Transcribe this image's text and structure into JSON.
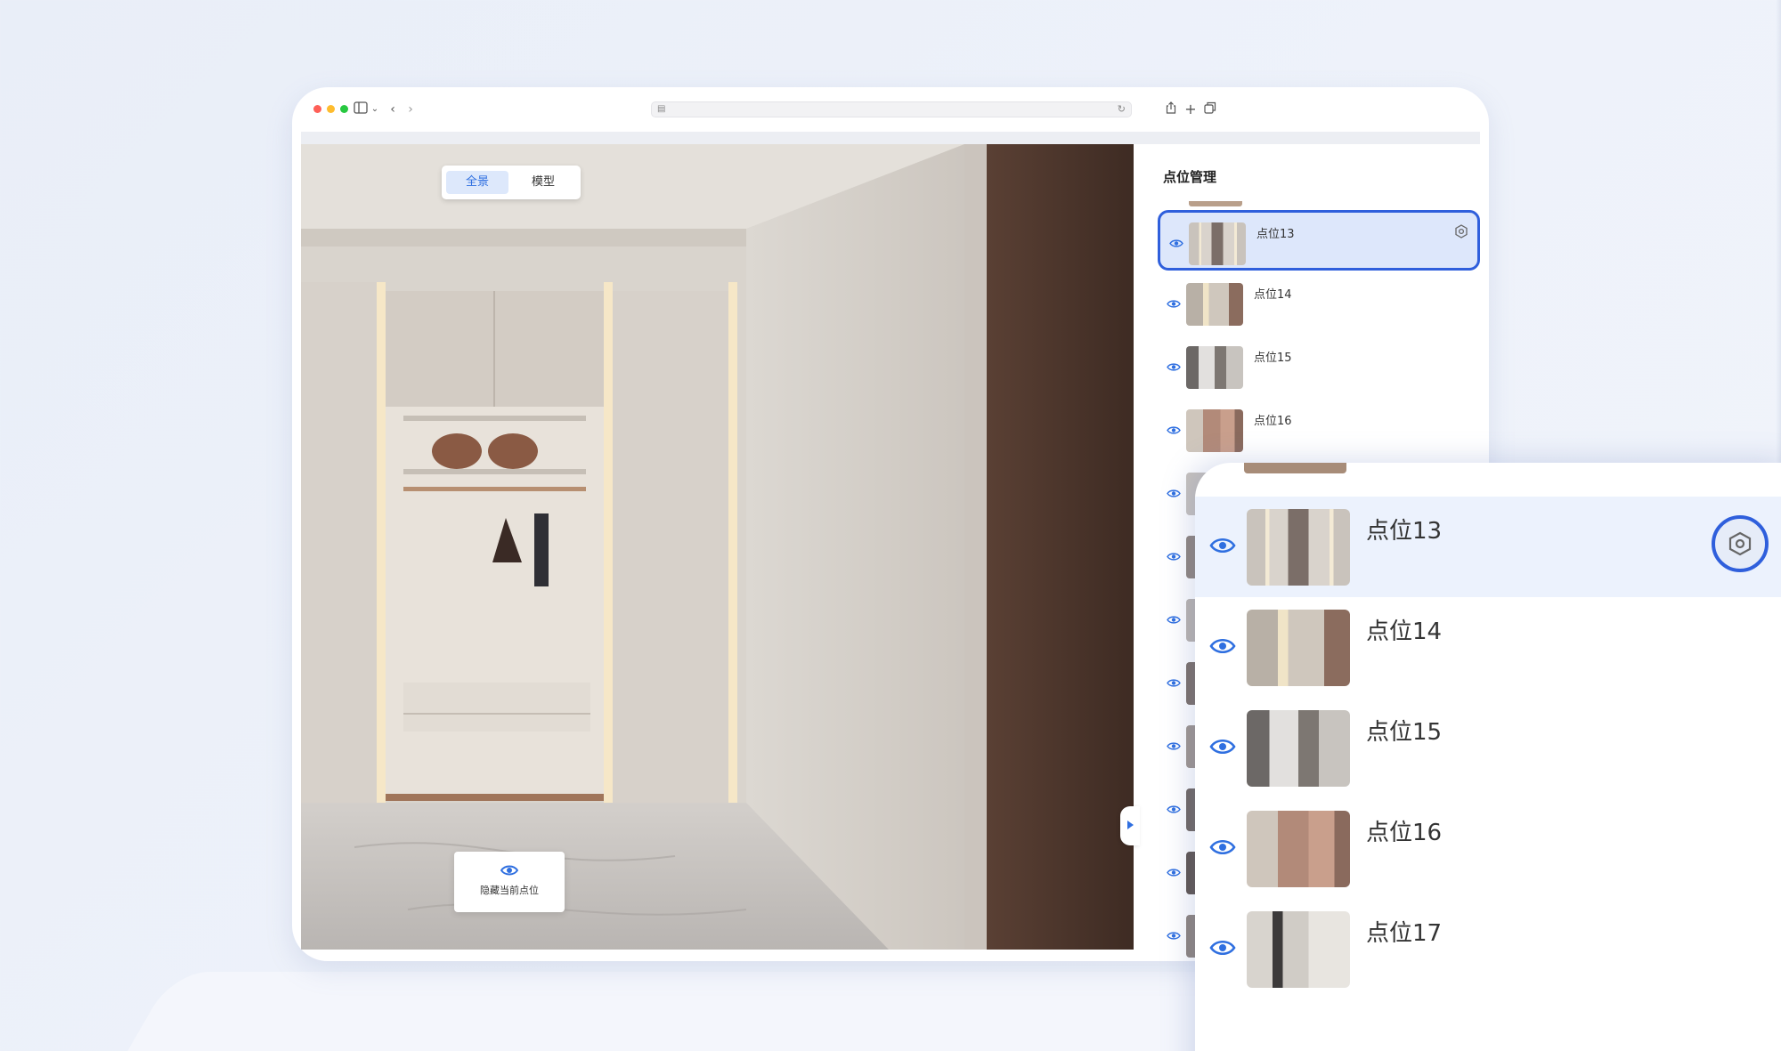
{
  "toggle": {
    "panorama": "全景",
    "model": "模型"
  },
  "viewer": {
    "hide_label": "隐藏当前点位"
  },
  "panel": {
    "title": "点位管理",
    "points": [
      {
        "name": "点位13",
        "selected": true
      },
      {
        "name": "点位14",
        "selected": false
      },
      {
        "name": "点位15",
        "selected": false
      },
      {
        "name": "点位16",
        "selected": false
      }
    ]
  },
  "zoom": {
    "points": [
      {
        "name": "点位13",
        "selected": true
      },
      {
        "name": "点位14",
        "selected": false
      },
      {
        "name": "点位15",
        "selected": false
      },
      {
        "name": "点位16",
        "selected": false
      },
      {
        "name": "点位17",
        "selected": false
      }
    ]
  },
  "colors": {
    "accent": "#2f6fe0",
    "selected_border": "#2f5fdc",
    "selected_bg": "#dde7fb"
  },
  "icons": [
    "sidebar-icon",
    "back-icon",
    "forward-icon",
    "share-icon",
    "new-tab-icon",
    "tabs-icon",
    "eye-icon",
    "settings-icon"
  ]
}
